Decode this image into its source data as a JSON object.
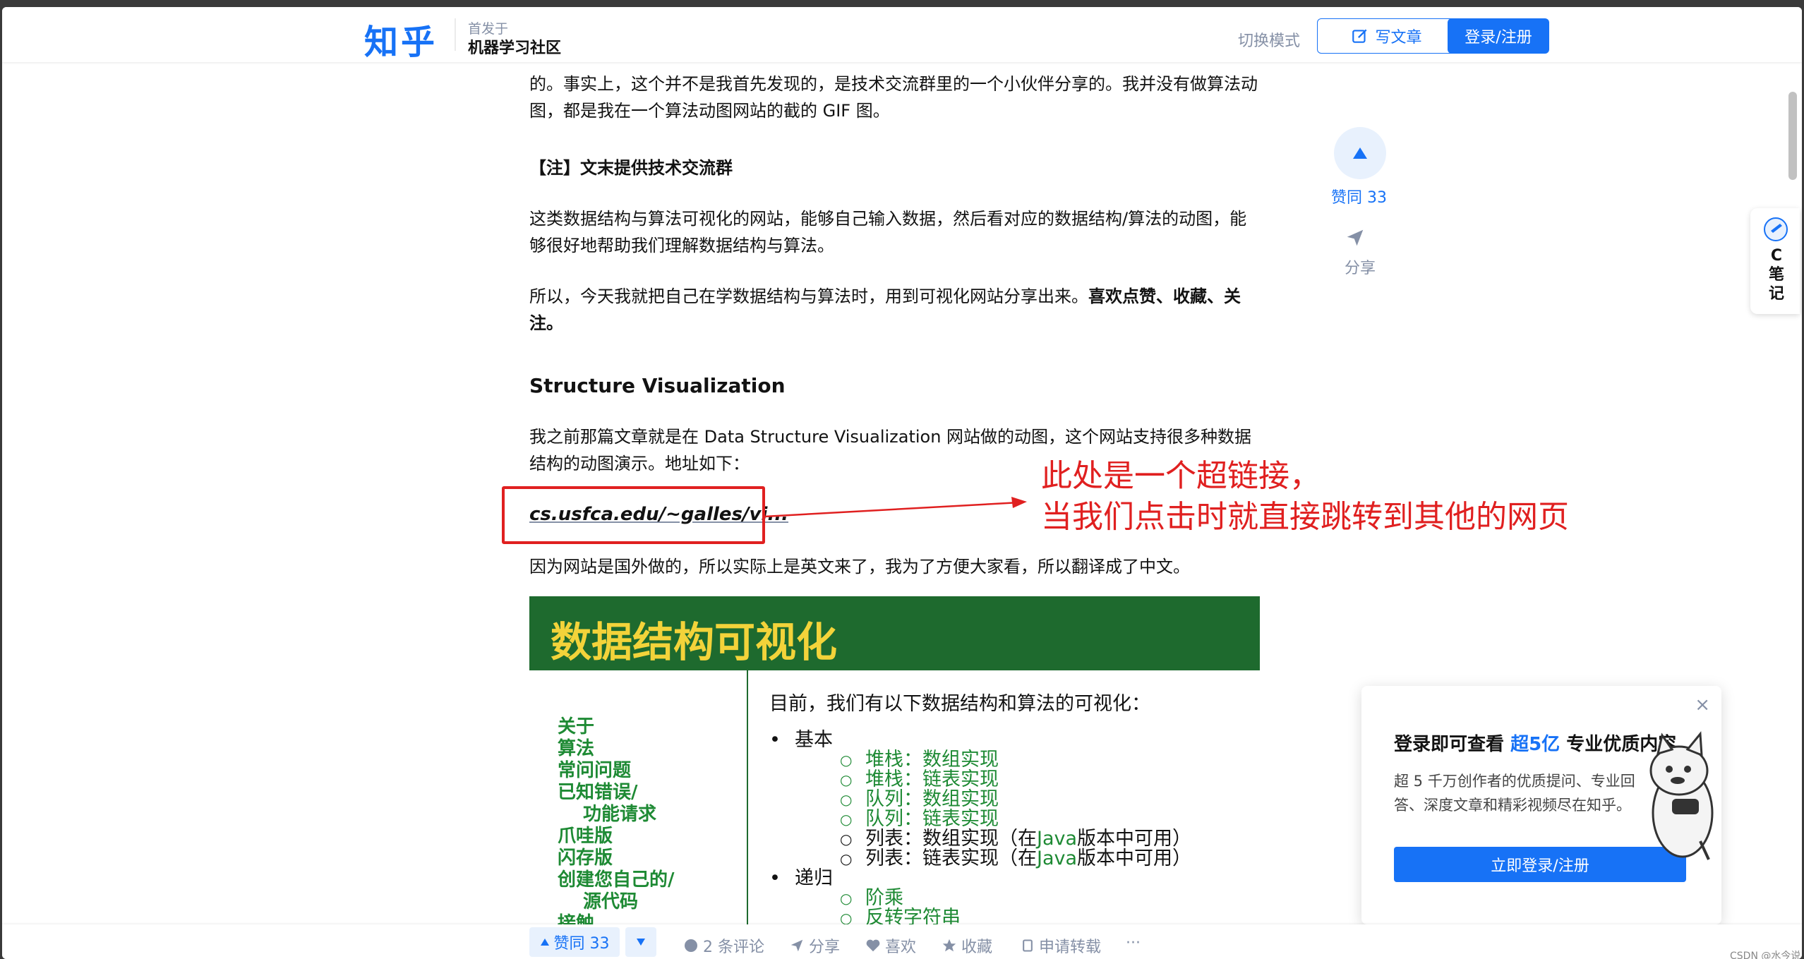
{
  "header": {
    "logo": "知乎",
    "published_in_label": "首发于",
    "publication_name": "机器学习社区",
    "mode_toggle": "切换模式",
    "write_article": "写文章",
    "login_register": "登录/注册"
  },
  "article": {
    "para_top": "的。事实上，这个并不是我首先发现的，是技术交流群里的一个小伙伴分享的。我并没有做算法动图，都是我在一个算法动图网站的截的 GIF 图。",
    "note": "【注】文末提供技术交流群",
    "para_intro": "这类数据结构与算法可视化的网站，能够自己输入数据，然后看对应的数据结构/算法的动图，能够很好地帮助我们理解数据结构与算法。",
    "para_share_plain": "所以，今天我就把自己在学数据结构与算法时，用到可视化网站分享出来。",
    "para_share_bold": "喜欢点赞、收藏、关注。",
    "section_title": "Structure Visualization",
    "para_site": "我之前那篇文章就是在 Data Structure Visualization 网站做的动图，这个网站支持很多种数据结构的动图演示。地址如下：",
    "link_text": "cs.usfca.edu/~galles/vi...",
    "para_translation": "因为网站是国外做的，所以实际上是英文来了，我为了方便大家看，所以翻译成了中文。",
    "annotation_line1": "此处是一个超链接，",
    "annotation_line2": "当我们点击时就直接跳转到其他的网页"
  },
  "embed": {
    "title": "数据结构可视化",
    "sidebar": [
      "关于",
      "算法",
      "常问问题",
      "已知错误/",
      "功能请求",
      "爪哇版",
      "闪存版",
      "创建您自己的/",
      "源代码",
      "接触"
    ],
    "heading": "目前，我们有以下数据结构和算法的可视化：",
    "basic": "基本",
    "basic_items": [
      {
        "green": "堆栈：数组实现",
        "rest": ""
      },
      {
        "green": "堆栈：链表实现",
        "rest": ""
      },
      {
        "green": "队列：数组实现",
        "rest": ""
      },
      {
        "green": "队列：链表实现",
        "rest": ""
      },
      {
        "green": "",
        "rest_pre": "列表：数组实现（在",
        "rest_green": "Java",
        "rest_post": "版本中可用）"
      },
      {
        "green": "",
        "rest_pre": "列表：链表实现（在",
        "rest_green": "Java",
        "rest_post": "版本中可用）"
      }
    ],
    "recursion": "递归",
    "recursion_items": [
      "阶乘",
      "反转字符串"
    ]
  },
  "side_actions": {
    "upvote_count": "赞同 33",
    "share": "分享"
  },
  "note_tab": {
    "letter": "C",
    "text": "笔记"
  },
  "bottom_bar": {
    "upvote": "赞同 33",
    "comments": "2 条评论",
    "share": "分享",
    "like": "喜欢",
    "collect": "收藏",
    "repost": "申请转载",
    "more": "···"
  },
  "popup": {
    "title_pre": "登录即可查看",
    "title_highlight": "超5亿",
    "title_post": "专业优质内容",
    "desc": "超 5 千万创作者的优质提问、专业回答、深度文章和精彩视频尽在知乎。",
    "button": "立即登录/注册"
  },
  "watermark": "CSDN @水今说",
  "colors": {
    "brand": "#1772f6",
    "annotation_red": "#e02020",
    "embed_header": "#1e6a2e",
    "embed_title": "#f3d33a",
    "embed_green": "#1e8a34"
  }
}
